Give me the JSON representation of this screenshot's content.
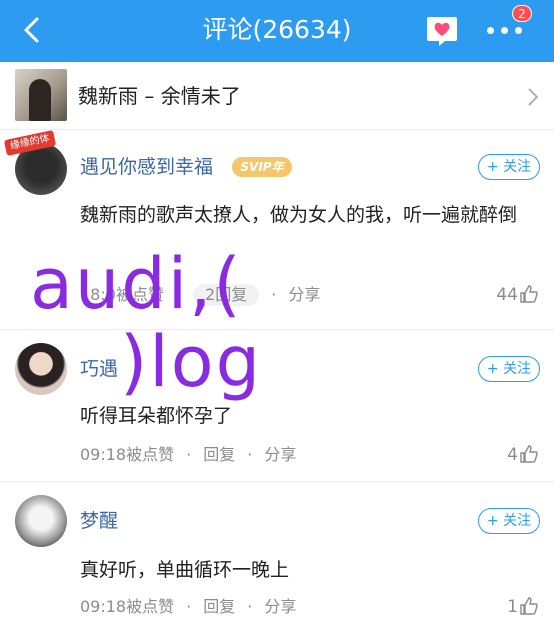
{
  "header": {
    "title": "评论(26634)",
    "badge": "2"
  },
  "song": {
    "title": "魏新雨 – 余情未了"
  },
  "comments": [
    {
      "user": "遇见你感到幸福",
      "vip": "SVIP年",
      "avatar_tag": "缘缘的体",
      "follow": "+ 关注",
      "text": "魏新雨的歌声太撩人，做为女人的我，听一遍就醉倒",
      "time": "18:0",
      "liked": "被点赞",
      "reply": "2回复",
      "share": "分享",
      "likes": "44"
    },
    {
      "user": "巧遇",
      "follow": "+ 关注",
      "text": "听得耳朵都怀孕了",
      "time": "09:18",
      "liked": "被点赞",
      "reply": "回复",
      "share": "分享",
      "likes": "4"
    },
    {
      "user": "梦醒",
      "follow": "+ 关注",
      "text": "真好听，单曲循环一晚上",
      "time": "09:18",
      "liked": "被点赞",
      "reply": "回复",
      "share": "分享",
      "likes": "1"
    }
  ],
  "overlay": {
    "line1": "audi,(",
    "line2": ")log"
  },
  "colors": {
    "accent": "#2d9cf0",
    "username": "#3b67a8",
    "overlay": "#8a2be2"
  },
  "icons": [
    "back-arrow-icon",
    "heart-chat-icon",
    "more-dots-icon",
    "chevron-right-icon",
    "thumb-up-icon"
  ]
}
